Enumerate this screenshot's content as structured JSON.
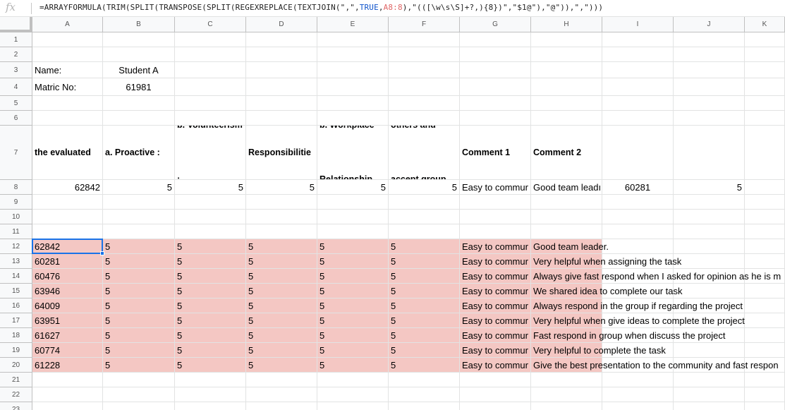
{
  "formula_bar": {
    "fx_label": "fx",
    "p1": "=ARRAYFORMULA(TRIM(SPLIT(TRANSPOSE(SPLIT(REGEXREPLACE(TEXTJOIN(\",\",",
    "p2": "TRUE",
    "p3": ",",
    "p4": "A8:8",
    "p5": "),\"(([\\w\\s\\S]+?,){8})\",\"$1@\"),\"@\")),\",\")))"
  },
  "columns": [
    "A",
    "B",
    "C",
    "D",
    "E",
    "F",
    "G",
    "H",
    "I",
    "J",
    "K"
  ],
  "rows": [
    "1",
    "2",
    "3",
    "4",
    "5",
    "6",
    "7",
    "8",
    "9",
    "10",
    "11",
    "12",
    "13",
    "14",
    "15",
    "16",
    "17",
    "18",
    "19",
    "20",
    "21",
    "22",
    "23"
  ],
  "info": {
    "name_label": "Name:",
    "name_value": "Student A",
    "matric_label": "Matric No:",
    "matric_value": "61981"
  },
  "headers": {
    "a": "Matric No of the evaluated member:",
    "b": "a. Proactive :",
    "c": "b. Volunteerism :",
    "d": "a. Job Responsibilitie s",
    "e": "b. Workplace Relationship",
    "f": "a. Respecting others and accept group opinions:",
    "g": "Comment 1",
    "h": "Comment 2"
  },
  "row8": {
    "a": "62842",
    "b": "5",
    "c": "5",
    "d": "5",
    "e": "5",
    "f": "5",
    "g": "Easy to commur",
    "h": "Good team leadı",
    "i": "60281",
    "j": "5"
  },
  "results": [
    {
      "a": "62842",
      "b": "5",
      "c": "5",
      "d": "5",
      "e": "5",
      "f": "5",
      "g": "Easy to commur",
      "h": "Good team leader."
    },
    {
      "a": "60281",
      "b": "5",
      "c": "5",
      "d": "5",
      "e": "5",
      "f": "5",
      "g": "Easy to commur",
      "h": "Very helpful when assigning the task"
    },
    {
      "a": "60476",
      "b": "5",
      "c": "5",
      "d": "5",
      "e": "5",
      "f": "5",
      "g": "Easy to commur",
      "h": "Always give fast respond when I asked for opinion as he is m"
    },
    {
      "a": "63946",
      "b": "5",
      "c": "5",
      "d": "5",
      "e": "5",
      "f": "5",
      "g": "Easy to commur",
      "h": "We shared idea to complete our task"
    },
    {
      "a": "64009",
      "b": "5",
      "c": "5",
      "d": "5",
      "e": "5",
      "f": "5",
      "g": "Easy to commur",
      "h": "Always respond in the group if regarding the project"
    },
    {
      "a": "63951",
      "b": "5",
      "c": "5",
      "d": "5",
      "e": "5",
      "f": "5",
      "g": "Easy to commur",
      "h": "Very helpful when give ideas to complete the project"
    },
    {
      "a": "61627",
      "b": "5",
      "c": "5",
      "d": "5",
      "e": "5",
      "f": "5",
      "g": "Easy to commur",
      "h": "Fast respond in group when discuss the project"
    },
    {
      "a": "60774",
      "b": "5",
      "c": "5",
      "d": "5",
      "e": "5",
      "f": "5",
      "g": "Easy to commur",
      "h": "Very helpful to complete the task"
    },
    {
      "a": "61228",
      "b": "5",
      "c": "5",
      "d": "5",
      "e": "5",
      "f": "5",
      "g": "Easy to commur",
      "h": "Give the best presentation to the community and fast respon"
    }
  ],
  "colors": {
    "result_fill": "#f4c7c3",
    "selection": "#1a73e8",
    "function_text": "#1155cc",
    "range_text": "#e06666"
  }
}
